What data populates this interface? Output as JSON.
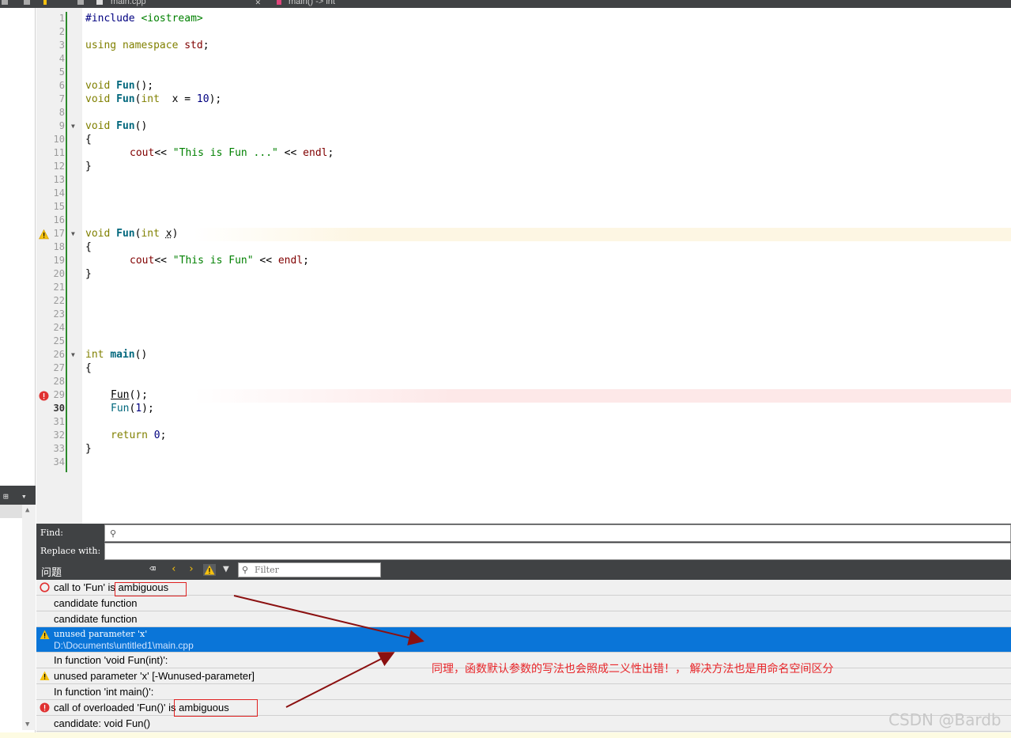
{
  "toolbar": {
    "file_tab": "main.cpp",
    "function_crumb": "main() -> int",
    "close": "✕"
  },
  "editor": {
    "lines": [
      {
        "n": "1"
      },
      {
        "n": "2"
      },
      {
        "n": "3"
      },
      {
        "n": "4"
      },
      {
        "n": "5"
      },
      {
        "n": "6"
      },
      {
        "n": "7"
      },
      {
        "n": "8"
      },
      {
        "n": "9"
      },
      {
        "n": "10"
      },
      {
        "n": "11"
      },
      {
        "n": "12"
      },
      {
        "n": "13"
      },
      {
        "n": "14"
      },
      {
        "n": "15"
      },
      {
        "n": "16"
      },
      {
        "n": "17"
      },
      {
        "n": "18"
      },
      {
        "n": "19"
      },
      {
        "n": "20"
      },
      {
        "n": "21"
      },
      {
        "n": "22"
      },
      {
        "n": "23"
      },
      {
        "n": "24"
      },
      {
        "n": "25"
      },
      {
        "n": "26"
      },
      {
        "n": "27"
      },
      {
        "n": "28"
      },
      {
        "n": "29"
      },
      {
        "n": "30"
      },
      {
        "n": "31"
      },
      {
        "n": "32"
      },
      {
        "n": "33"
      },
      {
        "n": "34"
      }
    ],
    "current_line": "30",
    "code": {
      "l1_pp": "#include",
      "l1_inc": " <iostream>",
      "l3_kw": "using namespace",
      "l3_id": " std",
      "l3_end": ";",
      "l6_type": "void",
      "l6_fn": "Fun",
      "l6_end": "();",
      "l7_type": "void",
      "l7_fn": "Fun",
      "l7_open": "(",
      "l7_int": "int",
      "l7_rest": "  x = ",
      "l7_num": "10",
      "l7_end": ");",
      "l9_type": "void",
      "l9_fn": "Fun",
      "l9_end": "()",
      "l10": "{",
      "l11_cout": "cout",
      "l11_op": "<< ",
      "l11_str": "\"This is Fun ...\"",
      "l11_op2": " << ",
      "l11_endl": "endl",
      "l11_end": ";",
      "l12": "}",
      "l17_type": "void",
      "l17_fn": "Fun",
      "l17_open": "(",
      "l17_int": "int",
      "l17_x": "x",
      "l17_end": ")",
      "l18": "{",
      "l19_cout": "cout",
      "l19_op": "<< ",
      "l19_str": "\"This is Fun\"",
      "l19_op2": " << ",
      "l19_endl": "endl",
      "l19_end": ";",
      "l20": "}",
      "l26_type": "int",
      "l26_fn": "main",
      "l26_end": "()",
      "l27": "{",
      "l29_call": "Fun",
      "l29_end": "();",
      "l30_call": "Fun",
      "l30_open": "(",
      "l30_num": "1",
      "l30_end": ");",
      "l32_kw": "return",
      "l32_num": " 0",
      "l32_end": ";",
      "l33": "}"
    }
  },
  "find": {
    "find_label": "Find:",
    "replace_label": "Replace with:"
  },
  "issues": {
    "title": "问题",
    "filter_placeholder": "Filter",
    "rows": [
      {
        "text": "call to 'Fun' is ambiguous",
        "type": "error-outline"
      },
      {
        "text": "candidate function",
        "type": "none"
      },
      {
        "text": "candidate function",
        "type": "none"
      },
      {
        "text": "unused parameter 'x'",
        "path": "D:\\Documents\\untitled1\\main.cpp",
        "type": "warning"
      },
      {
        "text": "In function 'void Fun(int)':",
        "type": "none"
      },
      {
        "text": "unused parameter 'x' [-Wunused-parameter]",
        "type": "warning"
      },
      {
        "text": "In function 'int main()':",
        "type": "none"
      },
      {
        "text": "call of overloaded 'Fun()' is ambiguous",
        "type": "error"
      },
      {
        "text": "candidate: void Fun()",
        "type": "none"
      }
    ]
  },
  "annotation": "同理，函数默认参数的写法也会照成二义性出错！，  解决方法也是用命名空间区分",
  "watermark": "CSDN @Bardb",
  "colors": {
    "selection": "#0a75d8",
    "annotation_red": "#e8262a",
    "arrow": "#8b1010",
    "warning": "#f5c10f",
    "error": "#e03131"
  }
}
